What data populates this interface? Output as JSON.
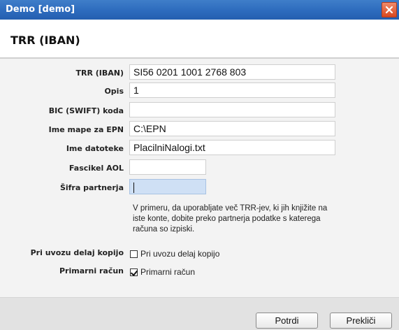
{
  "window": {
    "title": "Demo [demo]"
  },
  "header": {
    "title": "TRR (IBAN)"
  },
  "form": {
    "trr_label": "TRR (IBAN)",
    "trr_value": "SI56 0201 1001 2768 803",
    "opis_label": "Opis",
    "opis_value": "1",
    "bic_label": "BIC (SWIFT) koda",
    "bic_value": "",
    "mapa_label": "Ime mape za EPN",
    "mapa_value": "C:\\EPN",
    "datoteka_label": "Ime datoteke",
    "datoteka_value": "PlacilniNalogi.txt",
    "fascikel_label": "Fascikel AOL",
    "fascikel_value": "",
    "partner_label": "Šifra partnerja",
    "partner_value": "",
    "hint_text": "V primeru, da uporabljate več TRR-jev, ki jih knjižite na iste konte, dobite preko partnerja podatke s katerega računa so izpiski.",
    "kopija_label": "Pri uvozu delaj kopijo",
    "kopija_checkbox_label": "Pri uvozu delaj kopijo",
    "kopija_checked": false,
    "primarni_label": "Primarni račun",
    "primarni_checkbox_label": "Primarni račun",
    "primarni_checked": true
  },
  "footer": {
    "confirm_label": "Potrdi",
    "cancel_label": "Prekliči"
  },
  "colors": {
    "titlebar": "#2d6bbd",
    "close": "#d9471f",
    "focused_field": "#cfe0f5"
  },
  "icons": {
    "close": "close-icon",
    "checkmark": "checkmark-icon"
  }
}
